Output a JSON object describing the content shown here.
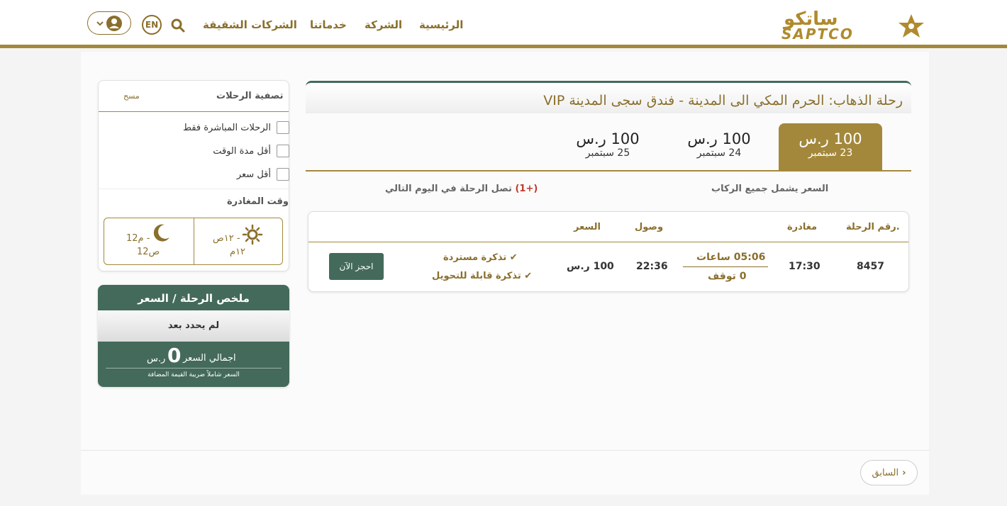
{
  "brand": {
    "logo_text_ar": "ساتكو",
    "logo_text_en": "SAPTCO",
    "gold": "#a3883c",
    "green": "#436a5a"
  },
  "nav": {
    "home": "الرئيسية",
    "company": "الشركة",
    "services": "خدماتنا",
    "sister_companies": "الشركات الشقيقة",
    "lang": "EN"
  },
  "trip": {
    "title": "رحلة الذهاب: الحرم المكي الى المدينة - فندق سجى المدينة VIP",
    "dates": [
      {
        "price": "100 ر.س",
        "date": "23 سبتمبر",
        "active": true
      },
      {
        "price": "100 ر.س",
        "date": "24 سبتمبر",
        "active": false
      },
      {
        "price": "100 ر.س",
        "date": "25 سبتمبر",
        "active": false
      }
    ],
    "note_price": "السعر يشمل جميع الركاب",
    "note_next_day_marker": "(+1)",
    "note_next_day": " تصل الرحلة في اليوم التالي"
  },
  "results": {
    "headers": {
      "trip_number": "رقم الرحلة.",
      "departure": "مغادرة",
      "arrival": "وصول",
      "price": "السعر"
    },
    "row": {
      "trip_number": "8457",
      "departure": "17:30",
      "duration": "05:06 ساعات",
      "stops": "0 توقف",
      "arrival": "22:36",
      "price": "100 ر.س",
      "feature_1": "تذكرة مستردة",
      "feature_2": "تذكرة قابلة للتحويل",
      "book_label": "احجز الآن"
    }
  },
  "filter": {
    "title": "تصفية الرحلات",
    "clear": "مسح",
    "options": [
      "الرحلات المباشرة فقط",
      "أقل مدة الوقت",
      "أقل سعر"
    ],
    "departure_time_title": "وقت المغادرة",
    "day_range_line1": "١٢ص -",
    "day_range_line2": "١٢م",
    "night_range_line1": "12م -",
    "night_range_line2": "12ص"
  },
  "summary": {
    "title": "ملخص الرحلة / السعر",
    "status": "لم يحدد بعد",
    "total_label": "اجمالي السعر",
    "total_value": "0",
    "currency": "ر.س",
    "vat_note": "السعر شاملاً ضريبة القيمة المضافة"
  },
  "footer": {
    "prev_label": "السابق"
  }
}
